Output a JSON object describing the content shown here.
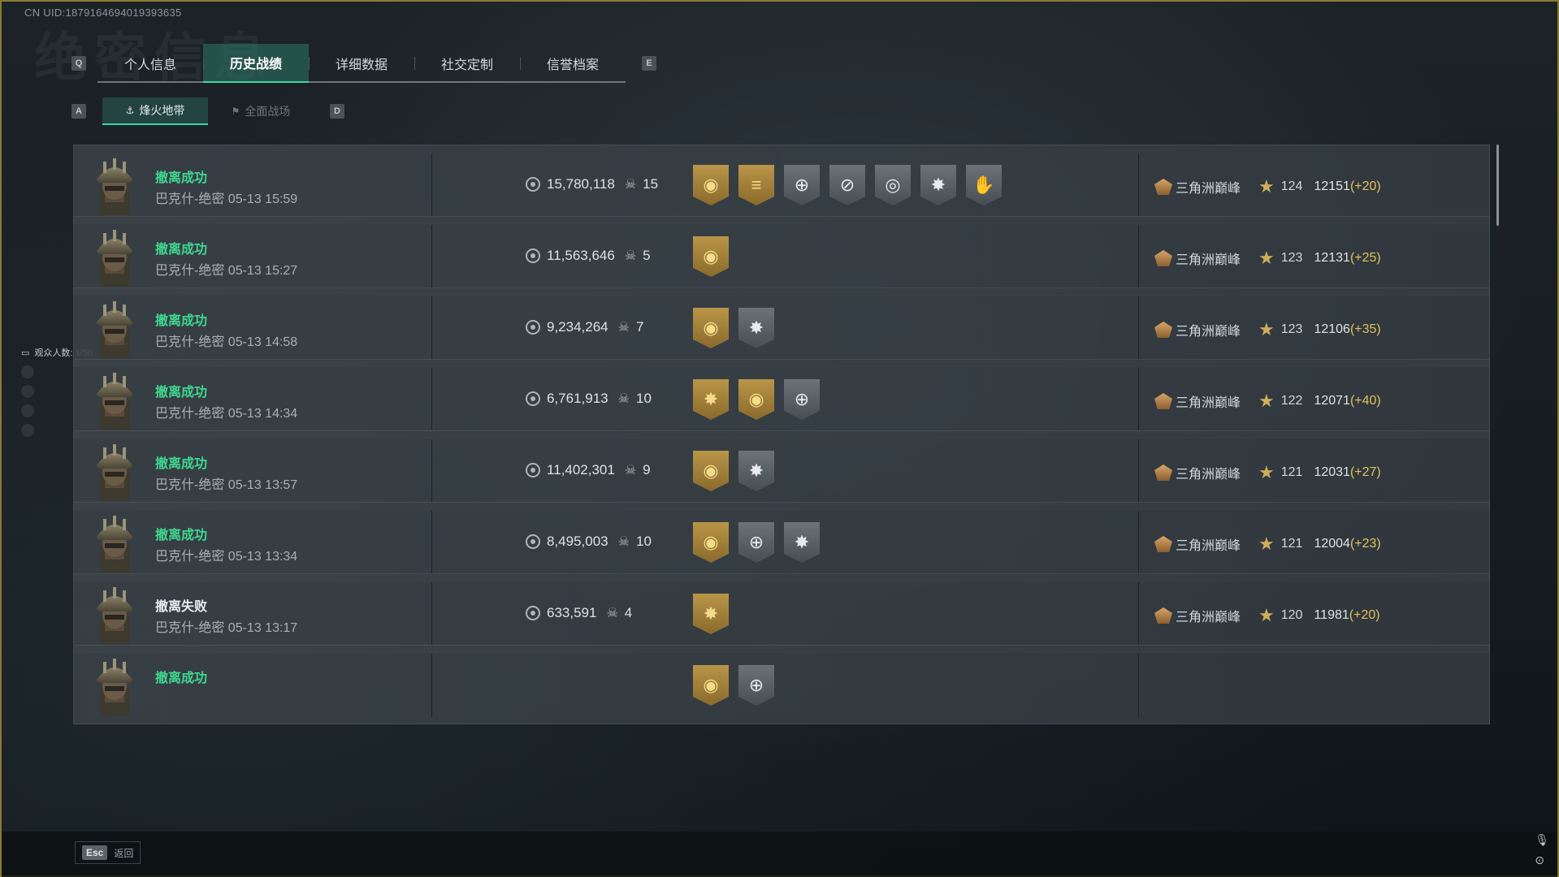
{
  "uid": "CN UID:1879164694019393635",
  "ghost_title": "绝密信息",
  "tabs": {
    "key_left": "Q",
    "key_right": "E",
    "items": [
      "个人信息",
      "历史战绩",
      "详细数据",
      "社交定制",
      "信誉档案"
    ],
    "active": "历史战绩"
  },
  "subtabs": {
    "key_left": "A",
    "key_right": "D",
    "items": [
      "烽火地带",
      "全面战场"
    ],
    "active": "烽火地带"
  },
  "viewers": {
    "label": "观众人数: 1/50"
  },
  "records": [
    {
      "status": "撤离成功",
      "map": "巴克什-绝密",
      "time": "05-13 15:59",
      "value": "15,780,118",
      "kills": "15",
      "badges": [
        {
          "icon": "coin-badge-icon",
          "tone": "gold"
        },
        {
          "icon": "stack-badge-icon",
          "tone": "gold"
        },
        {
          "icon": "crosshair-badge-icon",
          "tone": "silver"
        },
        {
          "icon": "crosshair-slash-badge-icon",
          "tone": "silver"
        },
        {
          "icon": "target-badge-icon",
          "tone": "silver"
        },
        {
          "icon": "burst-badge-icon",
          "tone": "silver"
        },
        {
          "icon": "hand-badge-icon",
          "tone": "silver"
        }
      ],
      "rank": "三角洲巅峰",
      "stars": "124",
      "score": "12151",
      "delta": "(+20)"
    },
    {
      "status": "撤离成功",
      "map": "巴克什-绝密",
      "time": "05-13 15:27",
      "value": "11,563,646",
      "kills": "5",
      "badges": [
        {
          "icon": "coin-badge-icon",
          "tone": "gold"
        }
      ],
      "rank": "三角洲巅峰",
      "stars": "123",
      "score": "12131",
      "delta": "(+25)"
    },
    {
      "status": "撤离成功",
      "map": "巴克什-绝密",
      "time": "05-13 14:58",
      "value": "9,234,264",
      "kills": "7",
      "badges": [
        {
          "icon": "coin-badge-icon",
          "tone": "gold"
        },
        {
          "icon": "burst-badge-icon",
          "tone": "silver"
        }
      ],
      "rank": "三角洲巅峰",
      "stars": "123",
      "score": "12106",
      "delta": "(+35)"
    },
    {
      "status": "撤离成功",
      "map": "巴克什-绝密",
      "time": "05-13 14:34",
      "value": "6,761,913",
      "kills": "10",
      "badges": [
        {
          "icon": "burst-badge-icon",
          "tone": "gold"
        },
        {
          "icon": "coin-badge-icon",
          "tone": "gold"
        },
        {
          "icon": "crosshair-badge-icon",
          "tone": "silver"
        }
      ],
      "rank": "三角洲巅峰",
      "stars": "122",
      "score": "12071",
      "delta": "(+40)"
    },
    {
      "status": "撤离成功",
      "map": "巴克什-绝密",
      "time": "05-13 13:57",
      "value": "11,402,301",
      "kills": "9",
      "badges": [
        {
          "icon": "coin-badge-icon",
          "tone": "gold"
        },
        {
          "icon": "burst-badge-icon",
          "tone": "silver"
        }
      ],
      "rank": "三角洲巅峰",
      "stars": "121",
      "score": "12031",
      "delta": "(+27)"
    },
    {
      "status": "撤离成功",
      "map": "巴克什-绝密",
      "time": "05-13 13:34",
      "value": "8,495,003",
      "kills": "10",
      "badges": [
        {
          "icon": "coin-badge-icon",
          "tone": "gold"
        },
        {
          "icon": "crosshair-badge-icon",
          "tone": "silver"
        },
        {
          "icon": "burst-badge-icon",
          "tone": "silver"
        }
      ],
      "rank": "三角洲巅峰",
      "stars": "121",
      "score": "12004",
      "delta": "(+23)"
    },
    {
      "status": "撤离失败",
      "map": "巴克什-绝密",
      "time": "05-13 13:17",
      "value": "633,591",
      "kills": "4",
      "badges": [
        {
          "icon": "burst-badge-icon",
          "tone": "gold"
        }
      ],
      "rank": "三角洲巅峰",
      "stars": "120",
      "score": "11981",
      "delta": "(+20)"
    },
    {
      "status": "撤离成功",
      "map": "",
      "time": "",
      "value": "",
      "kills": "",
      "badges": [
        {
          "icon": "coin-badge-icon",
          "tone": "gold"
        },
        {
          "icon": "crosshair-badge-icon",
          "tone": "silver"
        }
      ],
      "rank": "",
      "stars": "",
      "score": "",
      "delta": ""
    }
  ],
  "footer": {
    "esc_key": "Esc",
    "esc_label": "返回"
  },
  "colors": {
    "accent": "#3fd6a0",
    "success": "#3fd88f",
    "delta": "#e1c35a",
    "gold_badge": "#b99548",
    "silver_badge": "#6c7378"
  }
}
